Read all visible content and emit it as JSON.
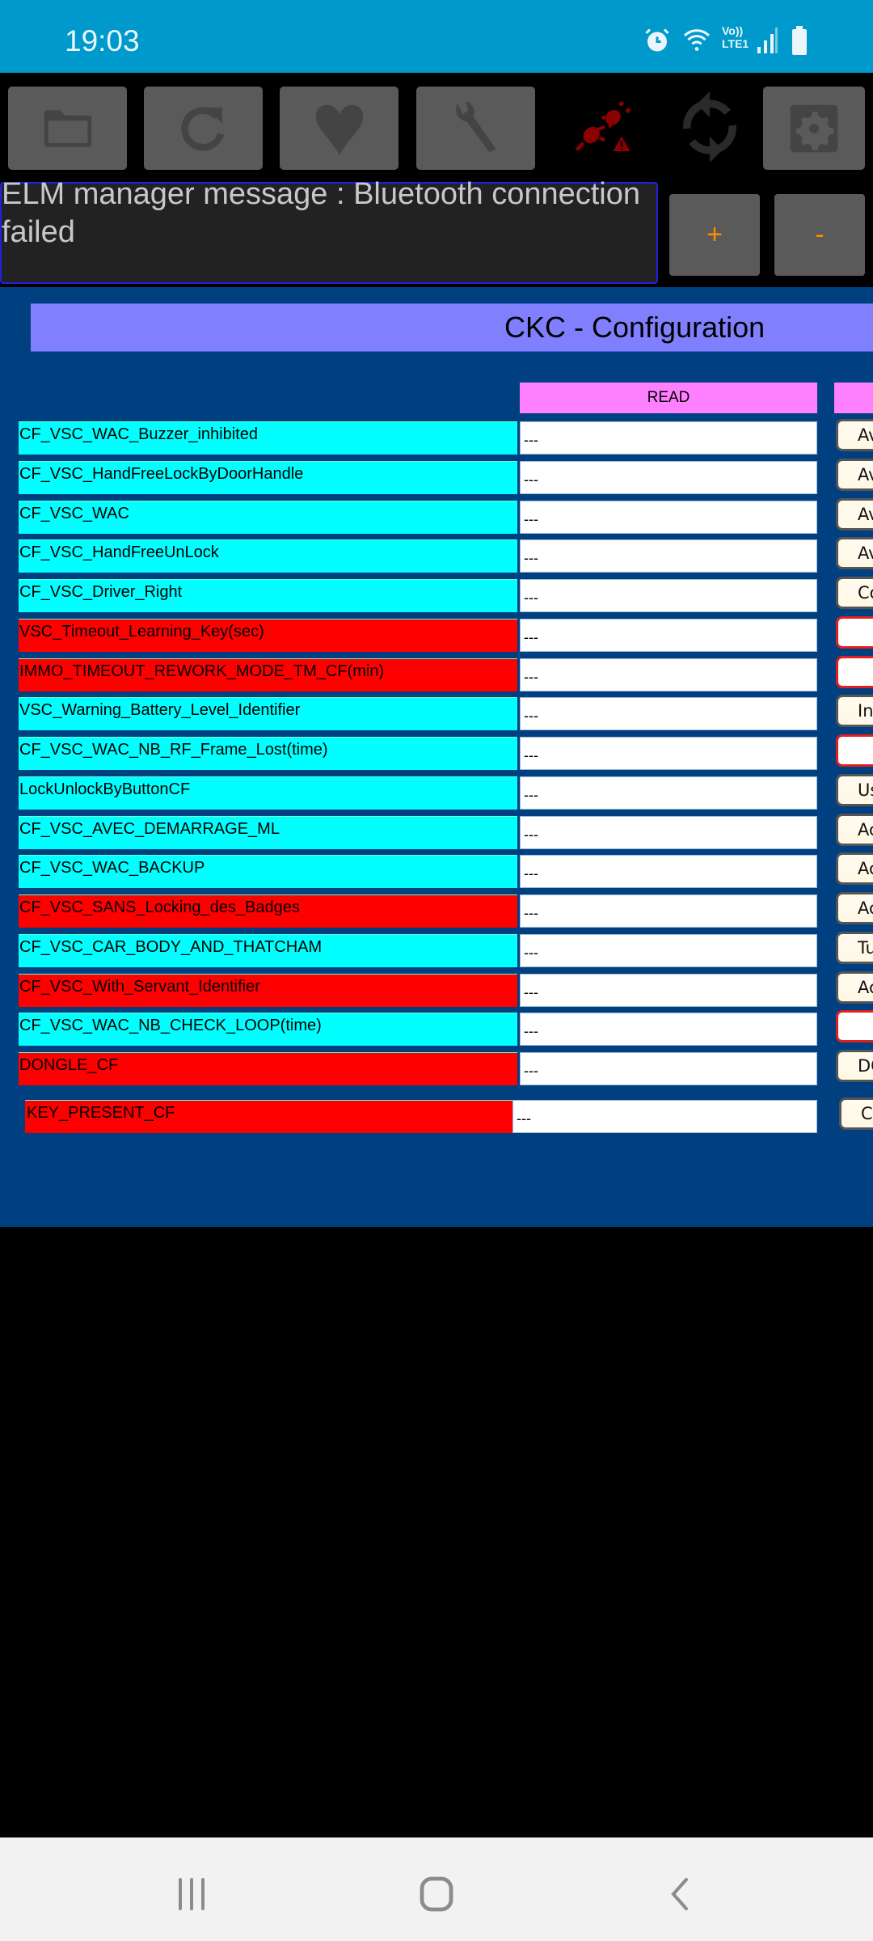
{
  "status_bar": {
    "time": "19:03",
    "icons": [
      "alarm-icon",
      "wifi-icon",
      "volte-lte-icon",
      "signal-icon",
      "battery-icon"
    ],
    "volte_label_top": "Vo))",
    "volte_label_bottom": "LTE1"
  },
  "toolbar": {
    "buttons": [
      {
        "icon": "folder-icon"
      },
      {
        "icon": "refresh-icon"
      },
      {
        "icon": "heart-icon"
      },
      {
        "icon": "wrench-icon"
      },
      {
        "icon": "disconnected-plug-icon",
        "color": "#8B0000"
      },
      {
        "icon": "sync-icon"
      },
      {
        "icon": "settings-icon"
      }
    ]
  },
  "message": {
    "text": "ELM manager message : Bluetooth connection failed",
    "plus_label": "+",
    "minus_label": "-"
  },
  "page": {
    "title": "CKC - Configuration",
    "columns": {
      "read": "READ",
      "write": ""
    }
  },
  "colors": {
    "status_bar": "#0099CC",
    "panel": "#004080",
    "title_bar": "#8080FF",
    "column_header": "#FF80FF",
    "writable": "#00FFFF",
    "readonly": "#FF0000",
    "accent": "#FF8C00"
  },
  "rows": [
    {
      "name": "CF_VSC_WAC_Buzzer_inhibited",
      "color": "cyan",
      "read": "---",
      "write": "Av"
    },
    {
      "name": "CF_VSC_HandFreeLockByDoorHandle",
      "color": "cyan",
      "read": "---",
      "write": "Av"
    },
    {
      "name": "CF_VSC_WAC",
      "color": "cyan",
      "read": "---",
      "write": "Av"
    },
    {
      "name": "CF_VSC_HandFreeUnLock",
      "color": "cyan",
      "read": "---",
      "write": "Av"
    },
    {
      "name": "CF_VSC_Driver_Right",
      "color": "cyan",
      "read": "---",
      "write": "Co"
    },
    {
      "name": "VSC_Timeout_Learning_Key(sec)",
      "color": "red",
      "read": "---",
      "write": ""
    },
    {
      "name": "IMMO_TIMEOUT_REWORK_MODE_TM_CF(min)",
      "color": "red",
      "read": "---",
      "write": ""
    },
    {
      "name": "VSC_Warning_Battery_Level_Identifier",
      "color": "cyan",
      "read": "---",
      "write": "Inh"
    },
    {
      "name": "CF_VSC_WAC_NB_RF_Frame_Lost(time)",
      "color": "cyan",
      "read": "---",
      "write": ""
    },
    {
      "name": "LockUnlockByButtonCF",
      "color": "cyan",
      "read": "---",
      "write": "Us"
    },
    {
      "name": "CF_VSC_AVEC_DEMARRAGE_ML",
      "color": "cyan",
      "read": "---",
      "write": "Ac"
    },
    {
      "name": "CF_VSC_WAC_BACKUP",
      "color": "cyan",
      "read": "---",
      "write": "Ac"
    },
    {
      "name": "CF_VSC_SANS_Locking_des_Badges",
      "color": "red",
      "read": "---",
      "write": "Ac"
    },
    {
      "name": "CF_VSC_CAR_BODY_AND_THATCHAM",
      "color": "cyan",
      "read": "---",
      "write": "Tu"
    },
    {
      "name": "CF_VSC_With_Servant_Identifier",
      "color": "red",
      "read": "---",
      "write": "Ac"
    },
    {
      "name": "CF_VSC_WAC_NB_CHECK_LOOP(time)",
      "color": "cyan",
      "read": "---",
      "write": ""
    },
    {
      "name": "DONGLE_CF",
      "color": "red",
      "read": "---",
      "write": "DO"
    },
    {
      "name": "KEY_PRESENT_CF",
      "color": "red",
      "read": "---",
      "write": "Cl"
    }
  ],
  "nav_bar": {
    "icons": [
      "recent-apps-icon",
      "home-icon",
      "back-icon"
    ]
  }
}
